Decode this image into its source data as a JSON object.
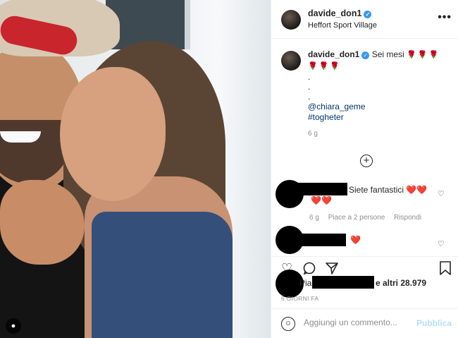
{
  "post": {
    "username": "davide_don1",
    "location": "Heffort Sport Village",
    "more_icon": "•••"
  },
  "caption": {
    "username": "davide_don1",
    "text": "Sei mesi",
    "roses_line1": "🌹🌹🌹",
    "roses_line2": "🌹🌹🌹",
    "dots": [
      ".",
      ".",
      "."
    ],
    "mention": "@chiara_geme",
    "hashtag": "#togheter",
    "time": "6 g"
  },
  "comments": [
    {
      "text": "Siete fantastici",
      "hearts_inline": "❤️❤️",
      "hearts_next": "❤️❤️",
      "time": "6 g",
      "likes": "Piace a 2 persone",
      "reply": "Rispondi"
    },
    {
      "hearts_inline": "❤️"
    }
  ],
  "likes": {
    "prefix": "Piace",
    "others": "e altri 28.979"
  },
  "date": "6 GIORNI FA",
  "add_comment": {
    "placeholder": "Aggiungi un commento...",
    "publish": "Pubblica"
  },
  "colors": {
    "link": "#00376b",
    "verified": "#3897f0",
    "publish_disabled": "#b2dffc",
    "heart": "#e0245e"
  },
  "icons": [
    "verified-icon",
    "more-icon",
    "add-circle-icon",
    "heart-icon",
    "comment-icon",
    "share-icon",
    "bookmark-icon",
    "emoji-icon",
    "user-tag-icon"
  ]
}
